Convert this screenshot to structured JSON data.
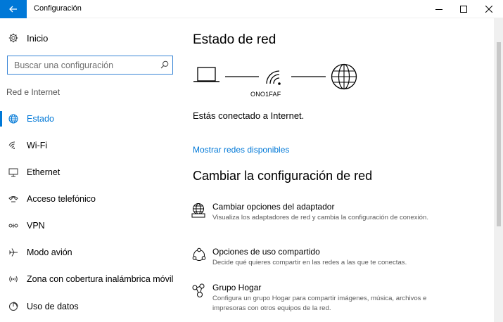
{
  "window": {
    "title": "Configuración"
  },
  "sidebar": {
    "home_label": "Inicio",
    "search": {
      "placeholder": "Buscar una configuración"
    },
    "section_label": "Red e Internet",
    "items": [
      {
        "label": "Estado",
        "icon": "globe-network-icon",
        "active": true
      },
      {
        "label": "Wi-Fi",
        "icon": "wifi-icon",
        "active": false
      },
      {
        "label": "Ethernet",
        "icon": "ethernet-icon",
        "active": false
      },
      {
        "label": "Acceso telefónico",
        "icon": "dial-up-icon",
        "active": false
      },
      {
        "label": "VPN",
        "icon": "vpn-icon",
        "active": false
      },
      {
        "label": "Modo avión",
        "icon": "airplane-icon",
        "active": false
      },
      {
        "label": "Zona con cobertura inalámbrica móvil",
        "icon": "hotspot-icon",
        "active": false
      },
      {
        "label": "Uso de datos",
        "icon": "data-usage-icon",
        "active": false
      }
    ]
  },
  "main": {
    "title": "Estado de red",
    "network_name": "ONO1FAF",
    "status_text": "Estás conectado a Internet.",
    "show_networks_link": "Mostrar redes disponibles",
    "change_title": "Cambiar la configuración de red",
    "options": [
      {
        "title": "Cambiar opciones del adaptador",
        "description": "Visualiza los adaptadores de red y cambia la configuración de conexión.",
        "icon": "adapter-globe-icon"
      },
      {
        "title": "Opciones de uso compartido",
        "description": "Decide qué quieres compartir en las redes a las que te conectas.",
        "icon": "sharing-icon"
      },
      {
        "title": "Grupo Hogar",
        "description": "Configura un grupo Hogar para compartir imágenes, música, archivos e impresoras con otros equipos de la red.",
        "icon": "homegroup-icon"
      }
    ]
  },
  "colors": {
    "accent": "#0078d7"
  }
}
